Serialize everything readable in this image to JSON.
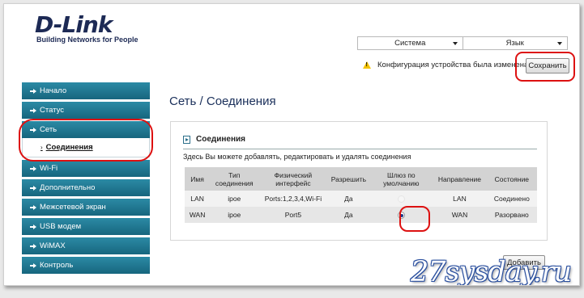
{
  "brand": {
    "name": "D-Link",
    "tagline": "Building Networks for People"
  },
  "header": {
    "menus": [
      {
        "label": "Система"
      },
      {
        "label": "Язык"
      }
    ],
    "notice": "Конфигурация устройства была изменена",
    "save_label": "Сохранить"
  },
  "sidebar": {
    "items": [
      {
        "label": "Начало"
      },
      {
        "label": "Статус"
      },
      {
        "label": "Сеть"
      },
      {
        "label": "Wi-Fi"
      },
      {
        "label": "Дополнительно"
      },
      {
        "label": "Межсетевой экран"
      },
      {
        "label": "USB модем"
      },
      {
        "label": "WiMAX"
      },
      {
        "label": "Контроль"
      }
    ],
    "active_sub": {
      "label": "Соединения"
    }
  },
  "main": {
    "title": "Сеть / Соединения",
    "panel": {
      "heading": "Соединения",
      "description": "Здесь Вы можете добавлять, редактировать и удалять соединения",
      "columns": [
        "Имя",
        "Тип соединения",
        "Физический интерфейс",
        "Разрешить",
        "Шлюз по умолчанию",
        "Направление",
        "Состояние"
      ],
      "rows": [
        {
          "name": "LAN",
          "type": "ipoe",
          "iface": "Ports:1,2,3,4,Wi-Fi",
          "enabled": "Да",
          "gateway_selected": false,
          "direction": "LAN",
          "state": "Соединено"
        },
        {
          "name": "WAN",
          "type": "ipoe",
          "iface": "Port5",
          "enabled": "Да",
          "gateway_selected": true,
          "direction": "WAN",
          "state": "Разорвано"
        }
      ]
    },
    "add_label": "Добавить"
  },
  "watermark": "27sysday.ru",
  "colors": {
    "sidebar": "#1f7b96",
    "highlight": "#dd1111",
    "title": "#1a2f5a"
  }
}
